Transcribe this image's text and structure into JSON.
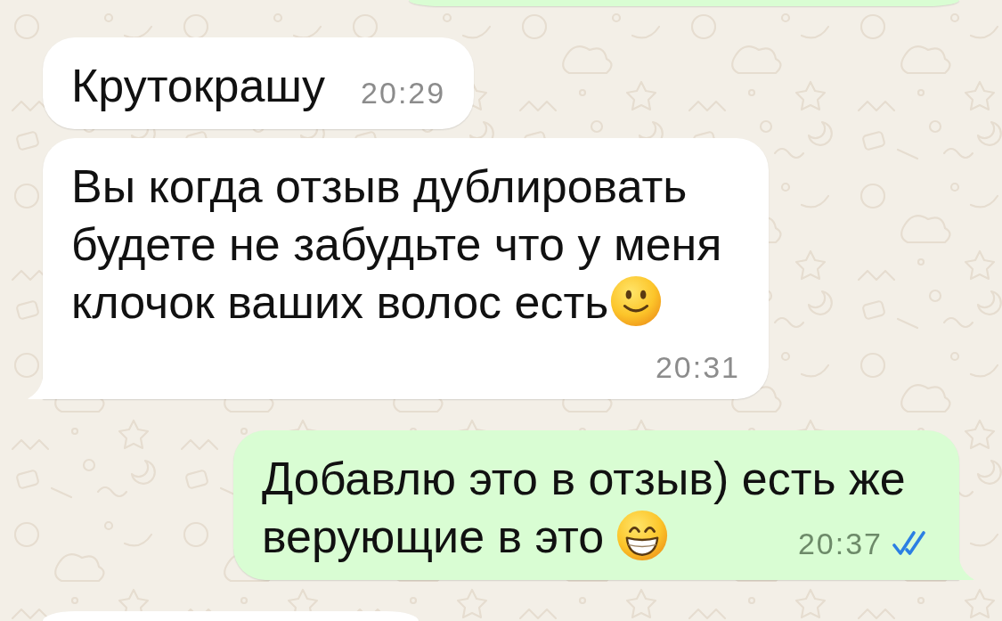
{
  "messages": [
    {
      "kind": "outgoing"
    },
    {
      "kind": "incoming",
      "lines": [
        "Крутокрашу"
      ],
      "time": "20:29",
      "tail": false
    },
    {
      "kind": "incoming",
      "lines": [
        "Вы когда отзыв дублировать",
        "будете не забудьте что у меня",
        "клочок ваших волос есть"
      ],
      "emoji": {
        "kind": "slightly_smiling"
      },
      "time": "20:31",
      "tail": true
    },
    {
      "kind": "outgoing",
      "lines": [
        "Добавлю это в отзыв) есть же",
        "верующие в это"
      ],
      "emoji": {
        "kind": "grinning"
      },
      "time": "20:37",
      "read": true,
      "tail": true
    },
    {
      "kind": "incoming"
    }
  ]
}
